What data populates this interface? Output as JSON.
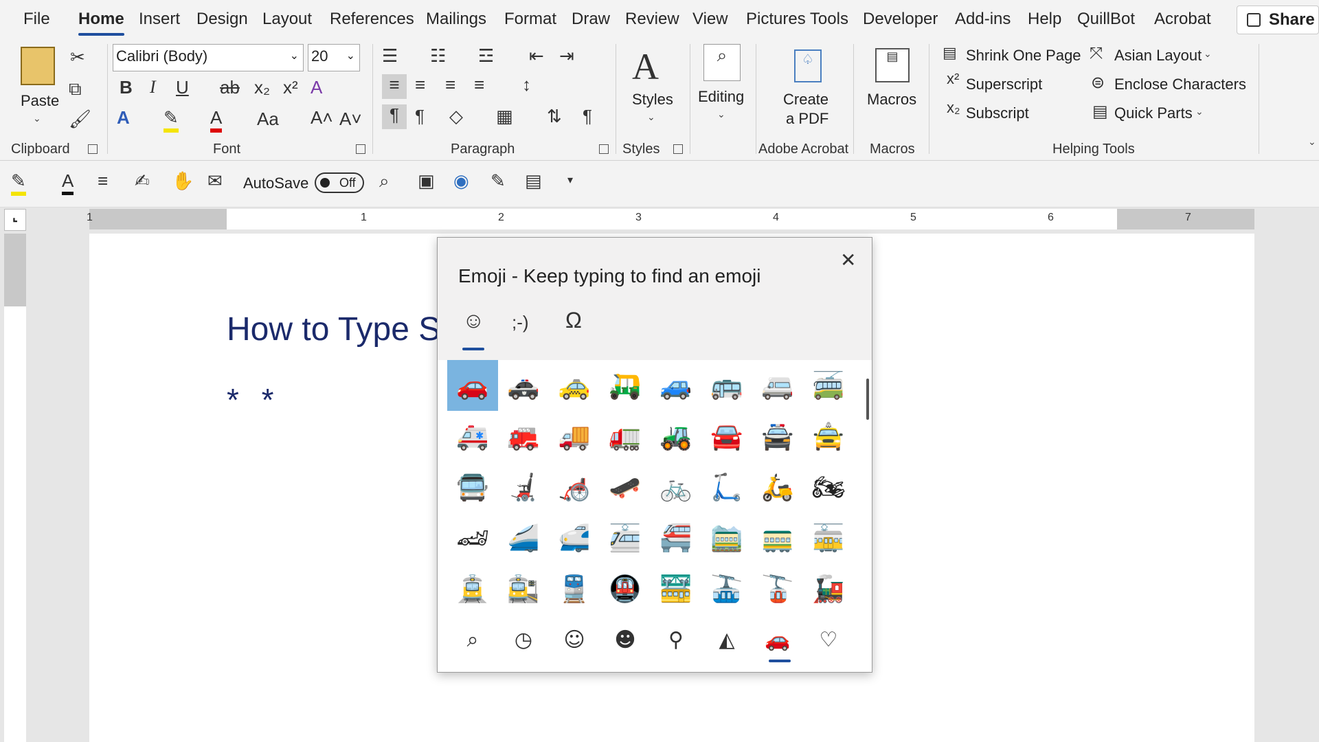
{
  "menu": {
    "tabs": [
      "File",
      "Home",
      "Insert",
      "Design",
      "Layout",
      "References",
      "Mailings",
      "Format",
      "Draw",
      "Review",
      "View",
      "Pictures Tools",
      "Developer",
      "Add-ins",
      "Help",
      "QuillBot",
      "Acrobat"
    ],
    "active": "Home",
    "share_label": "Share"
  },
  "ribbon": {
    "clipboard": {
      "paste_label": "Paste",
      "group_label": "Clipboard"
    },
    "font": {
      "font_name": "Calibri (Body)",
      "font_size": "20",
      "group_label": "Font"
    },
    "paragraph": {
      "group_label": "Paragraph"
    },
    "styles": {
      "styles_label": "Styles",
      "group_label": "Styles"
    },
    "editing": {
      "editing_label": "Editing"
    },
    "acrobat": {
      "create_pdf_line1": "Create",
      "create_pdf_line2": "a PDF",
      "group_label": "Adobe Acrobat"
    },
    "macros": {
      "macros_label": "Macros",
      "group_label": "Macros"
    },
    "helping": {
      "shrink_one_page": "Shrink One Page",
      "superscript": "Superscript",
      "subscript": "Subscript",
      "asian_layout": "Asian Layout",
      "enclose_characters": "Enclose Characters",
      "quick_parts": "Quick Parts",
      "group_label": "Helping Tools"
    }
  },
  "qat": {
    "autosave_label": "AutoSave",
    "autosave_state": "Off"
  },
  "ruler": {
    "numbers": [
      "1",
      "1",
      "2",
      "3",
      "4",
      "5",
      "6",
      "7"
    ]
  },
  "document": {
    "title": "How to Type S",
    "stars": "* *"
  },
  "emoji_panel": {
    "title": "Emoji - Keep typing to find an emoji",
    "tabs": [
      "☺",
      ";-)",
      "Ω"
    ],
    "grid": [
      [
        "🚗",
        "🚓",
        "🚕",
        "🛺",
        "🚙",
        "🚌",
        "🚐",
        "🚎"
      ],
      [
        "🚑",
        "🚒",
        "🚚",
        "🚛",
        "🚜",
        "🚘",
        "🚔",
        "🚖"
      ],
      [
        "🚍",
        "🦼",
        "🦽",
        "🛹",
        "🚲",
        "🛴",
        "🛵",
        "🏍"
      ],
      [
        "🏎",
        "🚄",
        "🚅",
        "🚈",
        "🚝",
        "🚞",
        "🚃",
        "🚋"
      ],
      [
        "🚊",
        "🚉",
        "🚆",
        "🚇",
        "🚟",
        "🚠",
        "🚡",
        "🚂"
      ]
    ],
    "categories": [
      "⌕",
      "◷",
      "☺",
      "☻",
      "⚲",
      "◭",
      "🚗",
      "♡"
    ],
    "colors": {
      "selected": "#7ab4e0",
      "accent": "#1f4f9e"
    }
  }
}
